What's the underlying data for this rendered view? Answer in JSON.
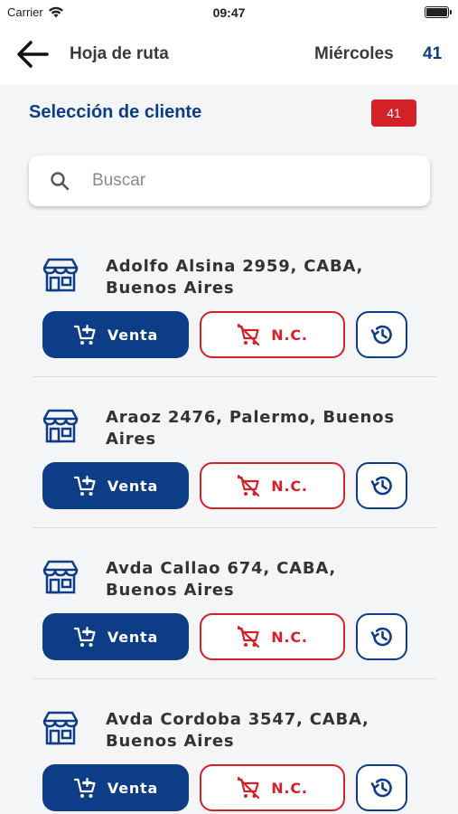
{
  "status_bar": {
    "carrier": "Carrier",
    "time": "09:47"
  },
  "header": {
    "title": "Hoja de ruta",
    "day": "Miércoles",
    "count": "41"
  },
  "section": {
    "title": "Selección de cliente",
    "badge": "41"
  },
  "search": {
    "placeholder": "Buscar",
    "value": ""
  },
  "buttons": {
    "sale_label": "Venta",
    "credit_note_label": "N.C."
  },
  "colors": {
    "brand_blue": "#0d3d86",
    "brand_red": "#d42027"
  },
  "icons": {
    "back": "back-arrow-icon",
    "search": "search-icon",
    "store": "store-icon",
    "sale": "cart-add-icon",
    "credit_note": "cart-remove-icon",
    "history": "history-icon"
  },
  "clients": [
    {
      "address": "Adolfo Alsina 2959, CABA, Buenos Aires"
    },
    {
      "address": "Araoz 2476, Palermo, Buenos Aires"
    },
    {
      "address": "Avda Callao 674, CABA, Buenos Aires"
    },
    {
      "address": "Avda Cordoba 3547, CABA, Buenos Aires"
    }
  ]
}
